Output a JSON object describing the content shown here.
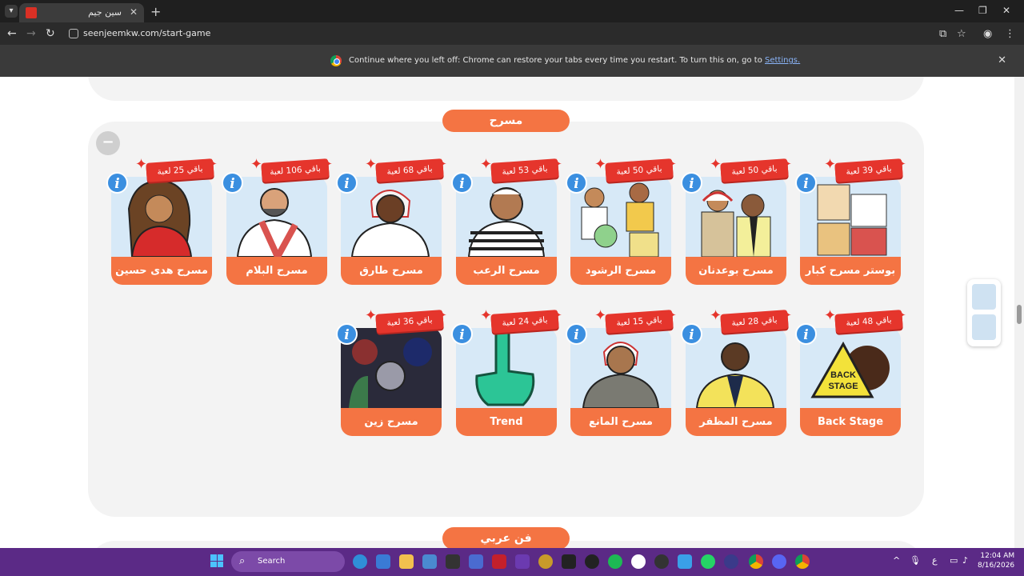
{
  "browser": {
    "tab_title": "سين جيم",
    "url": "seenjeemkw.com/start-game",
    "infobar_text": "Continue where you left off: Chrome can restore your tabs every time you restart. To turn this on, go to ",
    "infobar_link": "Settings."
  },
  "section": {
    "title": "مسرح",
    "collapse_label": "−",
    "next_title": "فن عربي"
  },
  "cards_row1": [
    {
      "name": "بوستر مسرح كبار",
      "remaining": "باقي 39 لعبة"
    },
    {
      "name": "مسرح بوعدنان",
      "remaining": "باقي 50 لعبة"
    },
    {
      "name": "مسرح الرشود",
      "remaining": "باقي 50 لعبة"
    },
    {
      "name": "مسرح الرعب",
      "remaining": "باقي 53 لعبة"
    },
    {
      "name": "مسرح طارق",
      "remaining": "باقي 68 لعبة"
    },
    {
      "name": "مسرح البلام",
      "remaining": "باقي 106 لعبة"
    },
    {
      "name": "مسرح هدى حسين",
      "remaining": "باقي 25 لعبة"
    }
  ],
  "cards_row2": [
    {
      "name": "Back Stage",
      "remaining": "باقي 48 لعبة"
    },
    {
      "name": "مسرح المظفر",
      "remaining": "باقي 28 لعبة"
    },
    {
      "name": "مسرح المانع",
      "remaining": "باقي 15 لعبة"
    },
    {
      "name": "Trend",
      "remaining": "باقي 24 لعبة"
    },
    {
      "name": "مسرح زين",
      "remaining": "باقي 36 لعبة"
    }
  ],
  "taskbar": {
    "search_placeholder": "Search",
    "time": "12:04 AM",
    "date": "8/16/2026",
    "lang": "ع"
  },
  "colors": {
    "accent_orange": "#f47443",
    "badge_red": "#e5352c",
    "info_blue": "#3b8fe0",
    "taskbar_purple": "#5b2a86"
  }
}
